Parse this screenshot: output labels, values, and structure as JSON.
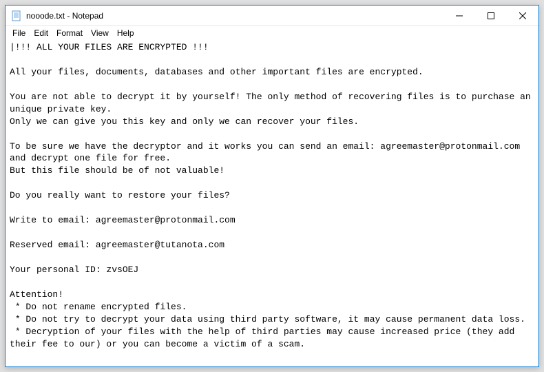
{
  "titlebar": {
    "title": "nooode.txt - Notepad"
  },
  "menubar": {
    "items": [
      "File",
      "Edit",
      "Format",
      "View",
      "Help"
    ]
  },
  "editor": {
    "lines": [
      "|!!! ALL YOUR FILES ARE ENCRYPTED !!!",
      "",
      "All your files, documents, databases and other important files are encrypted.",
      "",
      "You are not able to decrypt it by yourself! The only method of recovering files is to purchase an unique private key.",
      "Only we can give you this key and only we can recover your files.",
      "",
      "To be sure we have the decryptor and it works you can send an email: agreemaster@protonmail.com  and decrypt one file for free.",
      "But this file should be of not valuable!",
      "",
      "Do you really want to restore your files?",
      "",
      "Write to email: agreemaster@protonmail.com",
      "",
      "Reserved email: agreemaster@tutanota.com",
      "",
      "Your personal ID: zvsOEJ",
      "",
      "Attention!",
      " * Do not rename encrypted files.",
      " * Do not try to decrypt your data using third party software, it may cause permanent data loss.",
      " * Decryption of your files with the help of third parties may cause increased price (they add their fee to our) or you can become a victim of a scam."
    ]
  }
}
